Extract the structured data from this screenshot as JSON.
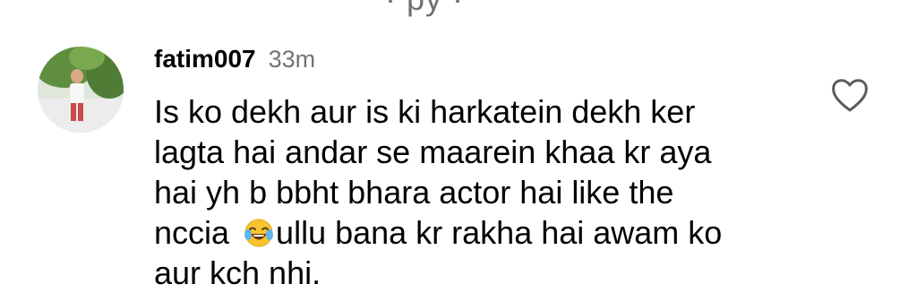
{
  "top_fragment": "· py ·",
  "comment": {
    "username": "fatim007",
    "timestamp": "33m",
    "lines": [
      "Is ko dekh aur is ki harkatein dekh ker",
      "lagta hai andar se maarein khaa kr aya",
      "hai yh b bbht bhara actor hai like the",
      "nccia ",
      "ullu bana kr rakha hai awam ko",
      "aur kch nhi."
    ],
    "emoji": "face-with-tears-of-joy"
  },
  "icons": {
    "like": "heart-outline-icon"
  }
}
